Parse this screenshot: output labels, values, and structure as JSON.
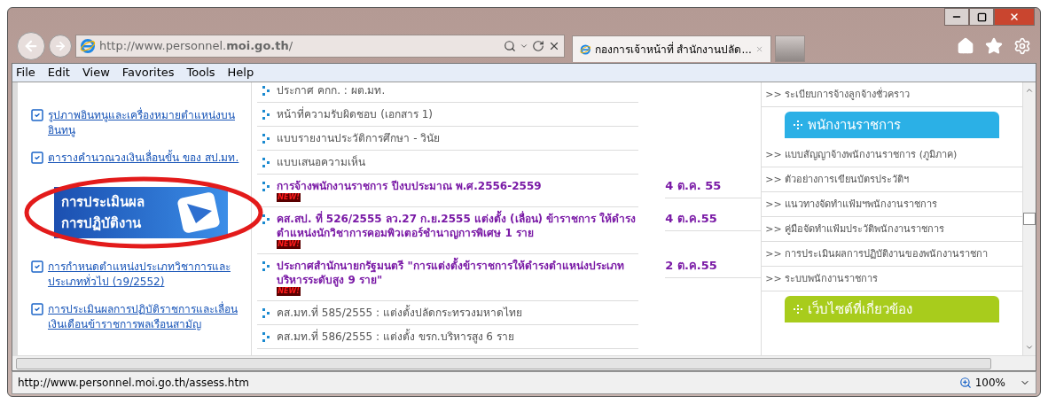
{
  "address_bar": {
    "url": "http://www.personnel.**moi.go.th**/"
  },
  "tabs": [
    {
      "title": "กองการเจ้าหน้าที่ สำนักงานปลัด...",
      "selected": true
    }
  ],
  "menu": [
    "File",
    "Edit",
    "View",
    "Favorites",
    "Tools",
    "Help"
  ],
  "left_links": [
    {
      "kind": "link",
      "text": "รูปภาพอินทนูและเครื่องหมายตำแหน่งบนอินทนู"
    },
    {
      "kind": "link",
      "text": "ตารางคำนวณวงเงินเลื่อนขั้น ของ สป.มท."
    },
    {
      "kind": "banner",
      "lines": [
        "การประเมินผล",
        "การปฏิบัติงาน"
      ],
      "circled": true
    },
    {
      "kind": "link",
      "text": "การกำหนดตำแหน่งประเภทวิชาการและประเภททั่วไป (ว9/2552)"
    },
    {
      "kind": "link",
      "text": "การประเมินผลการปฏิบัติราชการและเลื่อนเงินเดือนข้าราชการพลเรือนสามัญ"
    }
  ],
  "news": [
    {
      "text": "ประกาศ คกก. : ผต.มท.",
      "bold": false
    },
    {
      "text": "หน้าที่ความรับผิดชอบ (เอกสาร 1)",
      "bold": false
    },
    {
      "text": "แบบรายงานประวัติการศึกษา - วินัย",
      "bold": false
    },
    {
      "text": "แบบเสนอความเห็น",
      "bold": false
    },
    {
      "text": "การจ้างพนักงานราชการ ปีงบประมาณ พ.ศ.2556-2559",
      "bold": true,
      "badge": "NEW!",
      "date": "4 ต.ค. 55"
    },
    {
      "text": "คส.สป. ที่ 526/2555 ลว.27 ก.ย.2555 แต่งตั้ง (เลื่อน) ข้าราชการ ให้ดำรงตำแหน่งนักวิชาการคอมพิวเตอร์ชำนาญการพิเศษ 1 ราย",
      "bold": true,
      "badge": "NEW!",
      "date": "4 ต.ค.55"
    },
    {
      "text": "ประกาศสำนักนายกรัฐมนตรี \"การแต่งตั้งข้าราชการให้ดำรงตำแหน่งประเภทบริหารระดับสูง 9 ราย\"",
      "bold": true,
      "badge": "NEW!",
      "date": "2 ต.ค.55"
    },
    {
      "text": "คส.มท.ที่ 585/2555 : แต่งตั้งปลัดกระทรวงมหาดไทย",
      "bold": false
    },
    {
      "text": "คส.มท.ที่ 586/2555 : แต่งตั้ง ขรก.บริหารสูง 6 ราย",
      "bold": false
    }
  ],
  "right_panel": [
    {
      "kind": "item",
      "text": ">> ระเบียบการจ้างลูกจ้างชั่วคราว"
    },
    {
      "kind": "header",
      "text": "พนักงานราชการ",
      "color": "#2bb0e6"
    },
    {
      "kind": "item",
      "text": ">> แบบสัญญาจ้างพนักงานราชการ (ภูมิภาค)"
    },
    {
      "kind": "item",
      "text": ">> ตัวอย่างการเขียนบัตรประวัติฯ"
    },
    {
      "kind": "item",
      "text": ">> แนวทางจัดทำแฟ้มฯพนักงานราชการ"
    },
    {
      "kind": "item",
      "text": ">> คู่มือจัดทำแฟ้มประวัติพนักงานราชการ"
    },
    {
      "kind": "item",
      "text": ">> การประเมินผลการปฏิบัติงานของพนักงานราชกา"
    },
    {
      "kind": "item",
      "text": ">> ระบบพนักงานราชการ"
    },
    {
      "kind": "header",
      "text": "เว็บไซต์ที่เกี่ยวข้อง",
      "color": "#a8cc1c"
    }
  ],
  "status_bar": {
    "url": "http://www.personnel.moi.go.th/assess.htm",
    "zoom": "100%"
  }
}
